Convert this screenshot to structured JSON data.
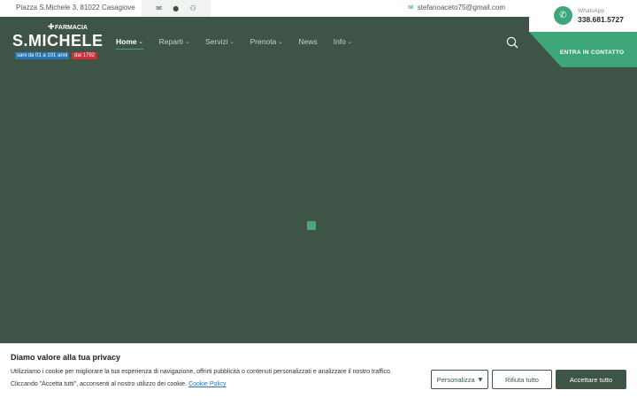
{
  "topbar": {
    "address": "Piazza S.Michele 3, 81022 Casagiove",
    "email": "stefanoaceto75@gmail.com"
  },
  "whatsapp": {
    "label": "WhatsApp",
    "number": "338.681.5727"
  },
  "cta": {
    "label": "ENTRA IN CONTATTO"
  },
  "logo": {
    "farmacia": "FARMACIA",
    "name": "S.MICHELE",
    "tagline": "sani da 01 a 101 anni",
    "since": "dal 1792"
  },
  "nav": {
    "items": [
      {
        "label": "Home",
        "dropdown": true,
        "active": true
      },
      {
        "label": "Reparti",
        "dropdown": true
      },
      {
        "label": "Servizi",
        "dropdown": true
      },
      {
        "label": "Prenota",
        "dropdown": true
      },
      {
        "label": "News",
        "dropdown": false
      },
      {
        "label": "Info",
        "dropdown": true
      }
    ]
  },
  "cookie": {
    "title": "Diamo valore alla tua privacy",
    "text1": "Utilizziamo i cookie per migliorare la tua esperienza di navigazione, offrirti pubblicità o contenuti personalizzati e analizzare il nostro traffico.",
    "text2": "Cliccando \"Accetta tutti\", acconsenti al nostro utilizzo dei cookie.",
    "policy_link": "Cookie Policy",
    "personalize": "Personalizza",
    "reject": "Rifiuta tutto",
    "accept": "Accettare tutto"
  },
  "colors": {
    "header_bg": "#3d5446",
    "accent": "#3fa67a",
    "since_red": "#d62a34",
    "tagline_blue": "#2a74b8"
  },
  "icons": {
    "social": [
      "envelope-icon",
      "facebook-icon",
      "people-icon"
    ],
    "email": "mail-icon",
    "whatsapp": "phone-icon",
    "search": "search-icon"
  }
}
